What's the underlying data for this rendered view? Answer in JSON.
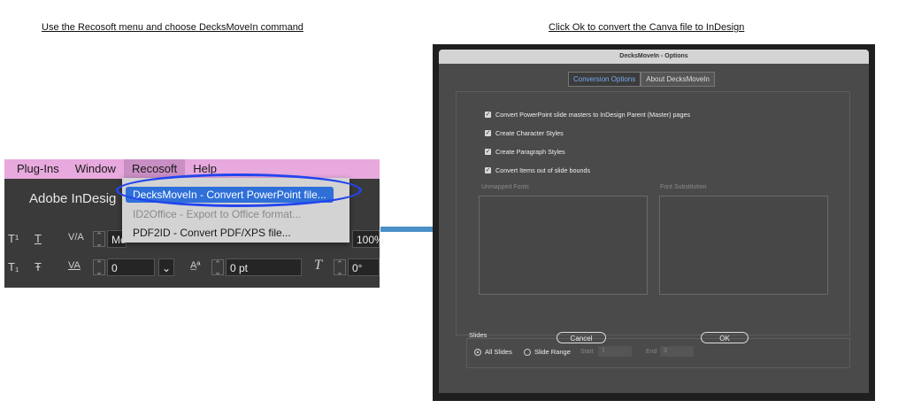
{
  "captions": {
    "left": "Use the Recosoft menu and choose DecksMoveIn command",
    "right": "Click Ok to convert the Canva file to InDesign"
  },
  "indesign": {
    "menubar": [
      "Plug-Ins",
      "Window",
      "Recosoft",
      "Help"
    ],
    "app_title": "Adobe InDesig",
    "toolbar_row1": {
      "glyph1": "T¹",
      "glyph2": "T",
      "glyph3": "V/A",
      "field": "Me",
      "percent": "100%"
    },
    "toolbar_row2": {
      "glyph1": "T₁",
      "glyph2": "Ŧ",
      "glyph3": "VA",
      "field1": "0",
      "field2": "0 pt",
      "field3": "0°"
    },
    "dropdown": {
      "items": [
        "DecksMoveIn - Convert PowerPoint file...",
        "ID2Office - Export to Office format...",
        "PDF2ID - Convert PDF/XPS file..."
      ]
    }
  },
  "dialog": {
    "title": "DecksMoveIn - Options",
    "tabs": [
      "Conversion Options",
      "About DecksMoveIn"
    ],
    "checkboxes": [
      "Convert PowerPoint slide masters to InDesign Parent (Master) pages",
      "Create Character Styles",
      "Create Paragraph Styles",
      "Convert Items out of slide bounds"
    ],
    "unmapped_fonts_label": "Unmapped Fonts",
    "font_substitution_label": "Font Substitution",
    "slides": {
      "label": "Slides",
      "all_slides": "All Slides",
      "slide_range": "Slide Range",
      "start_label": "Start",
      "start_value": "1",
      "end_label": "End",
      "end_value": "3"
    },
    "cancel_label": "Cancel",
    "ok_label": "OK"
  },
  "colors": {
    "menubar_bg": "#e7a9de",
    "highlight_ring": "#2244ee",
    "arrow": "#4a90c8",
    "active_tab_text": "#76aaf0"
  }
}
